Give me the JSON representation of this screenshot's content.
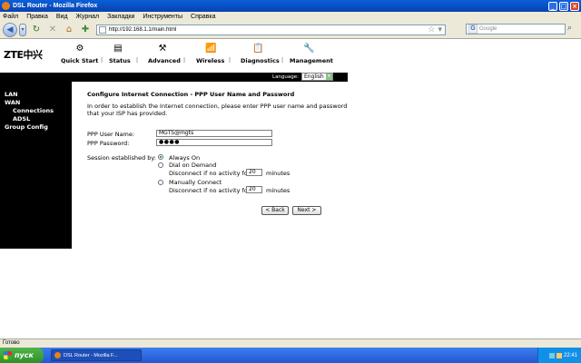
{
  "window": {
    "title": "DSL Router - Mozilla Firefox"
  },
  "menu": [
    "Файл",
    "Правка",
    "Вид",
    "Журнал",
    "Закладки",
    "Инструменты",
    "Справка"
  ],
  "toolbar": {
    "url": "http://192.168.1.1/main.html",
    "search_placeholder": "Google"
  },
  "header": {
    "logo": "ZTE中兴",
    "nav": [
      "Quick Start",
      "Status",
      "Advanced",
      "Wireless",
      "Diagnostics",
      "Management"
    ],
    "language_label": "Language:",
    "language_value": "English"
  },
  "sidebar": {
    "items": [
      "LAN",
      "WAN",
      "Connections",
      "ADSL",
      "Group Config"
    ]
  },
  "content": {
    "title": "Configure Internet Connection - PPP User Name and Password",
    "intro": "In order to establish the Internet connection, please enter PPP user name and password that your ISP has provided.",
    "username_label": "PPP User Name:",
    "username_value": "MGTS@mgts",
    "password_label": "PPP Password:",
    "password_value": "●●●●",
    "session_label": "Session established by:",
    "opt_always": "Always On",
    "opt_demand": "Dial on Demand",
    "opt_demand_sub": "Disconnect if no activity for",
    "opt_demand_value": "20",
    "opt_manual": "Manually Connect",
    "opt_manual_sub": "Disconnect if no activity for",
    "opt_manual_value": "20",
    "minutes": "minutes",
    "back_label": "< Back",
    "next_label": "Next >"
  },
  "status": {
    "text": "Готово"
  },
  "taskbar": {
    "start": "пуск",
    "task": "DSL Router - Mozilla F...",
    "time": "22:41"
  }
}
